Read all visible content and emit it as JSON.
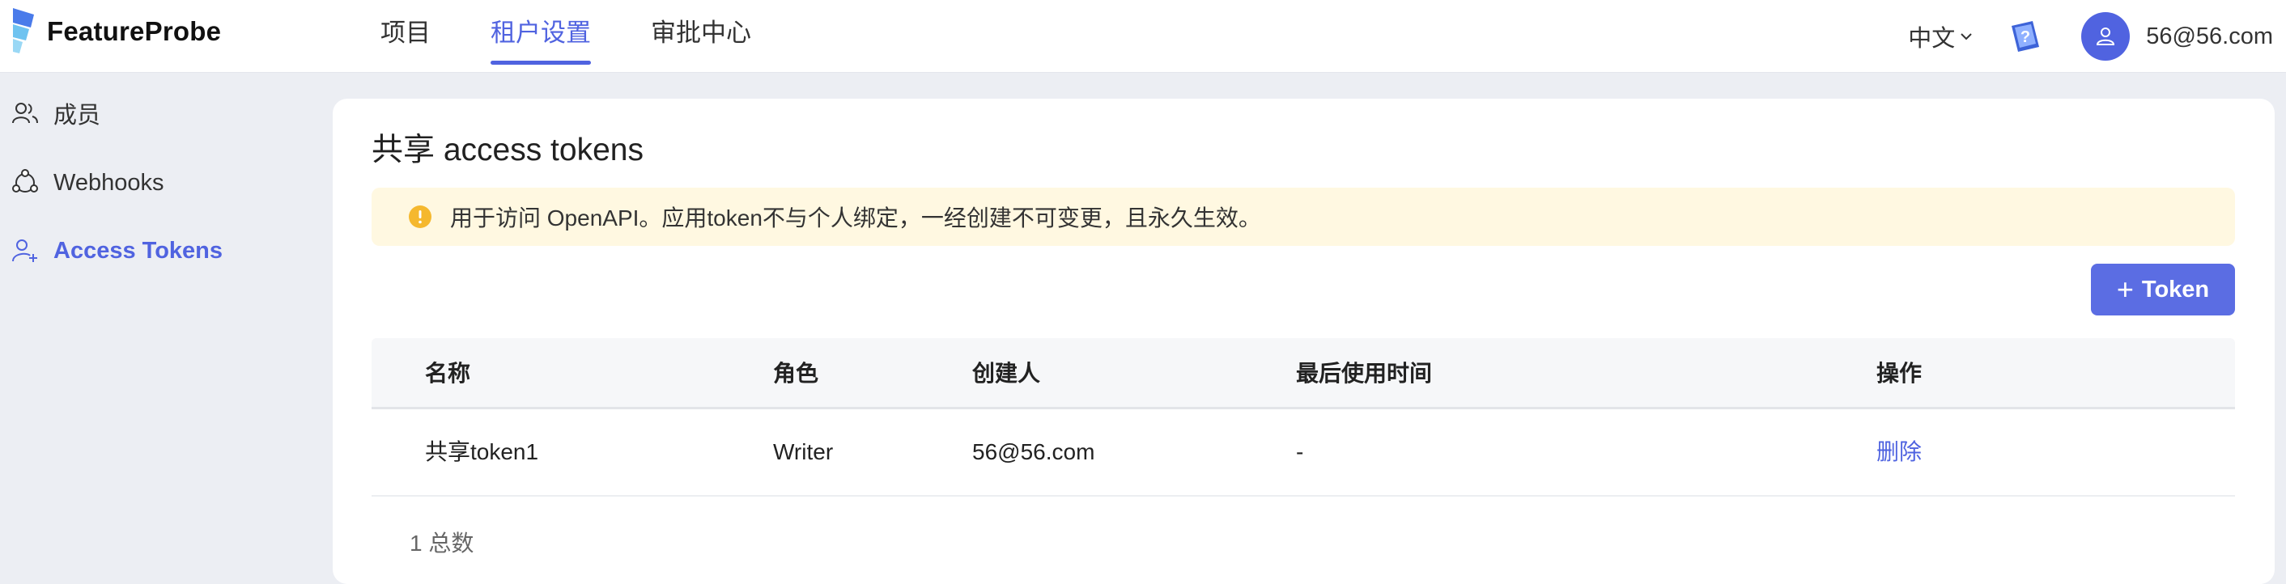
{
  "app": {
    "logo_text": "FeatureProbe"
  },
  "nav": {
    "items": [
      {
        "label": "项目",
        "active": false
      },
      {
        "label": "租户设置",
        "active": true
      },
      {
        "label": "审批中心",
        "active": false
      }
    ]
  },
  "header": {
    "language": "中文",
    "user_email": "56@56.com",
    "icons": [
      "chevron-down-icon",
      "help-icon",
      "user-icon"
    ],
    "accent_color": "#5063e0"
  },
  "sidebar": {
    "items": [
      {
        "label": "成员",
        "icon": "members-icon",
        "active": false
      },
      {
        "label": "Webhooks",
        "icon": "webhook-icon",
        "active": false
      },
      {
        "label": "Access Tokens",
        "icon": "user-plus-icon",
        "active": true
      }
    ]
  },
  "main": {
    "title": "共享 access tokens",
    "alert": {
      "icon": "warning-icon",
      "text": "用于访问 OpenAPI。应用token不与个人绑定，一经创建不可变更，且永久生效。",
      "color": "#fff8e1"
    },
    "add_button": {
      "label": "Token",
      "icon": "plus-icon",
      "color": "#5b6de3"
    },
    "table": {
      "columns": [
        "名称",
        "角色",
        "创建人",
        "最后使用时间",
        "操作"
      ],
      "rows": [
        {
          "name": "共享token1",
          "role": "Writer",
          "creator": "56@56.com",
          "last_used": "-",
          "action": "删除"
        }
      ]
    },
    "total_text": "1 总数"
  }
}
